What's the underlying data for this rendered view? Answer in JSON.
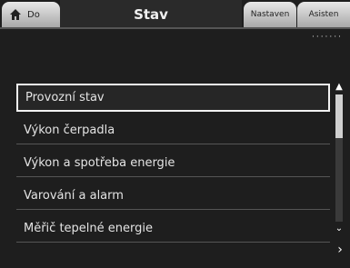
{
  "header": {
    "home_label": "Do",
    "title": "Stav",
    "settings_label": "Nastaven",
    "assist_label": "Asisten"
  },
  "pump_id": "·······",
  "menu": {
    "items": [
      {
        "label": "Provozní stav",
        "selected": true
      },
      {
        "label": "Výkon čerpadla",
        "selected": false
      },
      {
        "label": "Výkon a spotřeba energie",
        "selected": false
      },
      {
        "label": "Varování a alarm",
        "selected": false
      },
      {
        "label": "Měřič tepelné energie",
        "selected": false
      }
    ]
  },
  "scroll": {
    "up_icon": "chevron-up-icon",
    "down_icon": "chevron-down-icon",
    "position": 0
  },
  "colors": {
    "background": "#1e1e1e",
    "tab_active": "#2a2a2a",
    "tab_inactive": "#c8c8c8",
    "selection_border": "#f2f2f2"
  }
}
